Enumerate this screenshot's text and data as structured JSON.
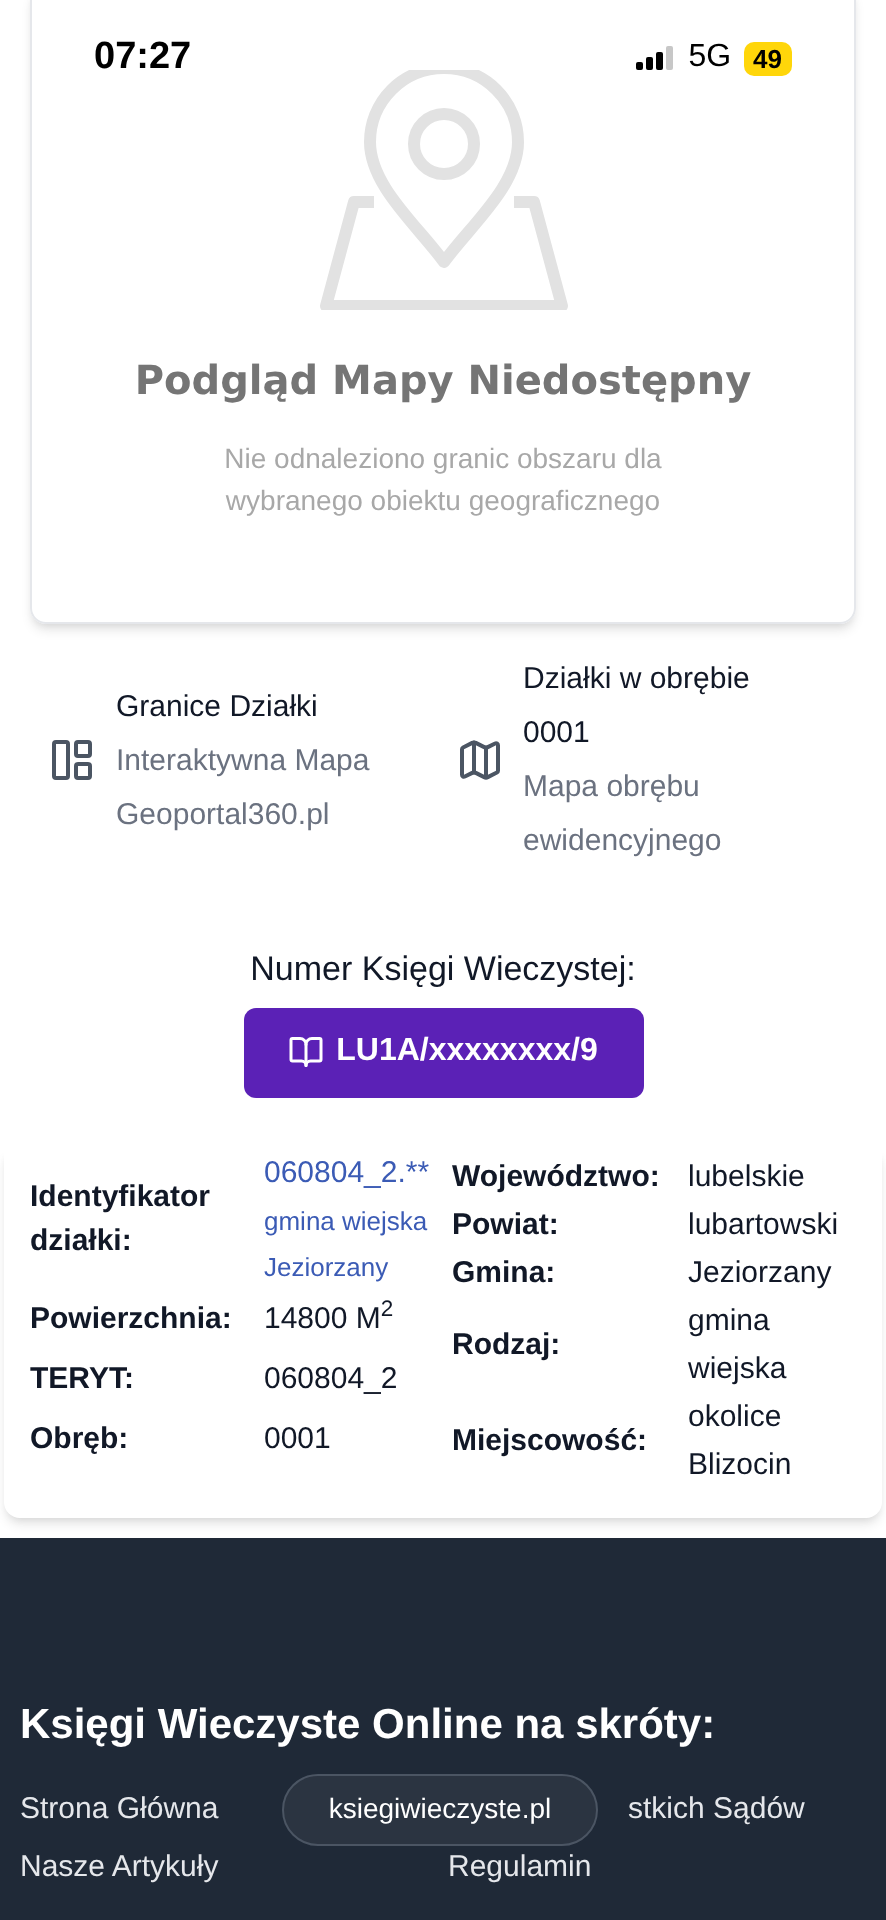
{
  "status_bar": {
    "time": "07:27",
    "network": "5G",
    "battery": "49"
  },
  "map_preview": {
    "title": "Podgląd Mapy Niedostępny",
    "message": "Nie odnaleziono granic obszaru dla wybranego obiektu geograficznego"
  },
  "links": [
    {
      "title": "Granice Działki",
      "lines": [
        "Interaktywna Mapa",
        "Geoportal360.pl"
      ]
    },
    {
      "title": "Działki w obrębie",
      "lines": [
        "0001",
        "Mapa obrębu",
        "ewidencyjnego"
      ]
    }
  ],
  "land_register": {
    "label": "Numer Księgi Wieczystej:",
    "number": "LU1A/xxxxxxxx/9"
  },
  "details_left": [
    {
      "label": "Identyfikator działki:",
      "values": [
        "060804_2.**",
        "gmina wiejska",
        "Jeziorzany"
      ],
      "kind": "link"
    },
    {
      "label": "Powierzchnia:",
      "values": [
        "14800 M$^{2}$"
      ],
      "kind": "text"
    },
    {
      "label": "TERYT:",
      "values": [
        "060804_2"
      ],
      "kind": "text"
    },
    {
      "label": "Obręb:",
      "values": [
        "0001"
      ],
      "kind": "text"
    }
  ],
  "details_right": [
    {
      "label": "Województwo:",
      "value": "lubelskie"
    },
    {
      "label": "Powiat:",
      "value": "lubartowski"
    },
    {
      "label": "Gmina:",
      "value": "Jeziorzany"
    },
    {
      "label": "Rodzaj:",
      "value": "gmina wiejska"
    },
    {
      "label": "Miejscowość:",
      "value": "okolice Blizocin"
    }
  ],
  "footer": {
    "title": "Księgi Wieczyste Online na skróty:",
    "links": [
      [
        "Strona Główna",
        "stkich Sądów"
      ],
      [
        "Nasze Artykuły",
        "Regulamin"
      ]
    ],
    "url_pill": "ksiegiwieczyste.pl"
  }
}
